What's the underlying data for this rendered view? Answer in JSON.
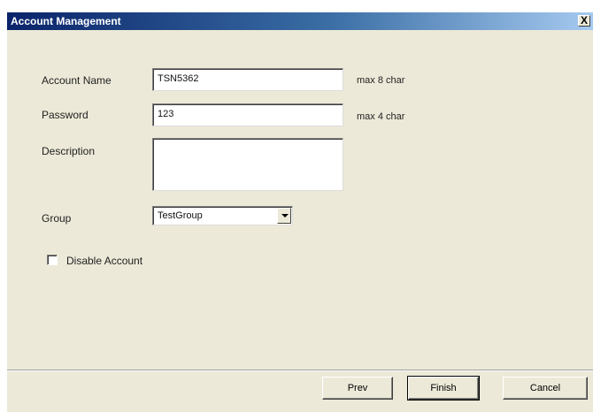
{
  "window": {
    "title": "Account Management",
    "close_glyph": "X"
  },
  "form": {
    "account_name": {
      "label": "Account Name",
      "value": "TSN5362",
      "hint": "max 8 char"
    },
    "password": {
      "label": "Password",
      "value": "123",
      "hint": "max 4 char"
    },
    "description": {
      "label": "Description",
      "value": ""
    },
    "group": {
      "label": "Group",
      "selected": "TestGroup"
    },
    "disable_account": {
      "label": "Disable Account",
      "checked": false
    }
  },
  "buttons": {
    "prev": "Prev",
    "finish": "Finish",
    "cancel": "Cancel"
  },
  "colors": {
    "title_start": "#0a246a",
    "title_end": "#a6caf0",
    "dialog_bg": "#ece9d8"
  }
}
